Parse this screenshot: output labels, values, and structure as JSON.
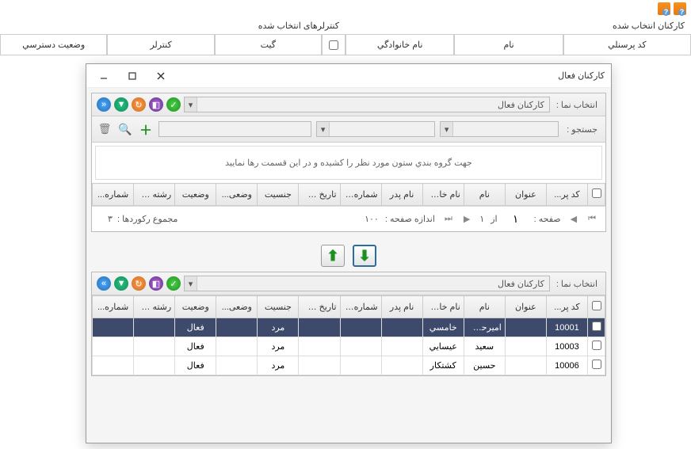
{
  "top": {
    "right_section_title": "کارکنان انتخاب شده",
    "left_section_title": "کنترلرهای انتخاب شده"
  },
  "upper_tabs_right": {
    "c1": "کد پرسنلي",
    "c2": "نام",
    "c3": "نام خانوادگي"
  },
  "upper_tabs_left": {
    "c1": "گیت",
    "c2": "کنترلر",
    "c3": "وضعیت دسترسي"
  },
  "dialog": {
    "title": "کارکنان فعال",
    "panel1": {
      "select_label": "انتخاب نما :",
      "select_value": "کارکنان فعال",
      "search_label": "جستجو :"
    },
    "group_hint": "جهت گروه بندي ستون مورد نظر را کشیده و در این قسمت رها نمایید",
    "grid1_headers": {
      "h0": "",
      "h1": "کد پر...",
      "h2": "عنوان",
      "h3": "نام",
      "h4": "نام خان...",
      "h5": "نام پدر",
      "h6": "شماره شنا...",
      "h7": "تاریخ ت...",
      "h8": "جنسیت",
      "h9": "وضعی...",
      "h10": "وضعیت",
      "h11": "رشته ت...",
      "h12": "شماره..."
    },
    "pager": {
      "page_label": "صفحه :",
      "page_value": "۱",
      "of_label": "از",
      "total_pages": "۱",
      "size_label": "اندازه صفحه :",
      "size_value": "۱۰۰",
      "records_label": "مجموع رکوردها :",
      "records_value": "۳"
    },
    "panel2": {
      "select_label": "انتخاب نما :",
      "select_value": "کارکنان فعال"
    },
    "grid2_headers": {
      "h0": "",
      "h1": "کد پر...",
      "h2": "عنوان",
      "h3": "نام",
      "h4": "نام خان...",
      "h5": "نام پدر",
      "h6": "شماره شنا...",
      "h7": "تاریخ ت...",
      "h8": "جنسیت",
      "h9": "وضعی...",
      "h10": "وضعیت",
      "h11": "رشته ت...",
      "h12": "شماره..."
    },
    "grid2_rows": [
      {
        "code": "10001",
        "title": "",
        "name": "امیرحسی...",
        "family": "خامسي",
        "father": "",
        "id": "",
        "dob": "",
        "gender": "مرد",
        "s1": "",
        "status": "فعال",
        "field": "",
        "num": ""
      },
      {
        "code": "10003",
        "title": "",
        "name": "سعید",
        "family": "عیسایي",
        "father": "",
        "id": "",
        "dob": "",
        "gender": "مرد",
        "s1": "",
        "status": "فعال",
        "field": "",
        "num": ""
      },
      {
        "code": "10006",
        "title": "",
        "name": "حسین",
        "family": "کشتکار",
        "father": "",
        "id": "",
        "dob": "",
        "gender": "مرد",
        "s1": "",
        "status": "فعال",
        "field": "",
        "num": ""
      }
    ]
  }
}
